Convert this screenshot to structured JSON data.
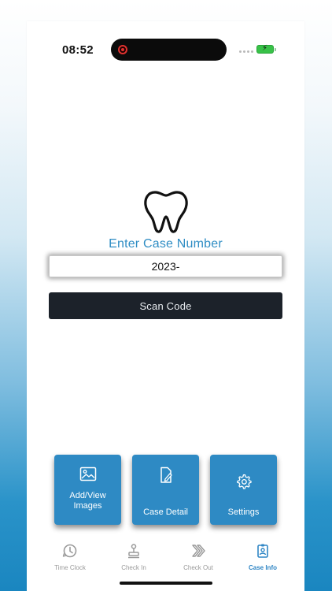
{
  "status_bar": {
    "time": "08:52"
  },
  "main": {
    "title": "Enter Case Number",
    "case_input_value": "2023-",
    "scan_button_label": "Scan Code"
  },
  "tiles": {
    "images_line1": "Add/View",
    "images_line2": "Images",
    "detail": "Case Detail",
    "settings": "Settings"
  },
  "tabs": [
    {
      "label": "Time Clock",
      "icon": "clock-icon"
    },
    {
      "label": "Check In",
      "icon": "stamp-icon"
    },
    {
      "label": "Check Out",
      "icon": "double-chevron-icon"
    },
    {
      "label": "Case Info",
      "icon": "id-badge-icon",
      "active": true
    }
  ],
  "colors": {
    "accent": "#2f8dc4",
    "tile": "#2e8ac4",
    "scan_button": "#1c222a",
    "active_tab": "#2f86c5",
    "inactive_tab": "#9a9a9a"
  }
}
